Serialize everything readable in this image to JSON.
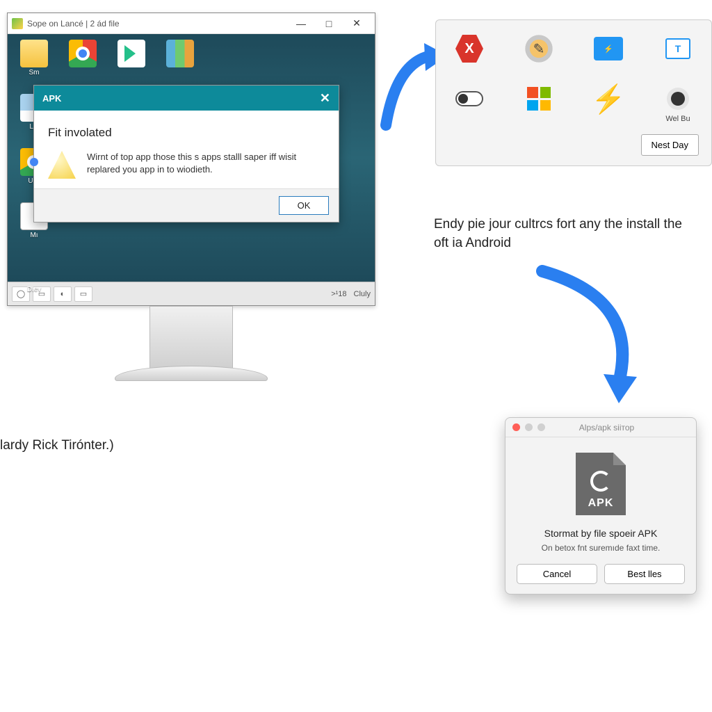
{
  "win_window": {
    "title": "Sope on Lancé | 2 ád file",
    "controls": {
      "min": "—",
      "max": "□",
      "close": "✕"
    }
  },
  "desktop_icons": [
    {
      "label": "Sm",
      "type": "folder"
    },
    {
      "label": "",
      "type": "chrome"
    },
    {
      "label": "",
      "type": "play"
    },
    {
      "label": "",
      "type": "bars"
    },
    {
      "label": "Loi",
      "type": "pic"
    },
    {
      "label": "",
      "type": "blank"
    },
    {
      "label": "",
      "type": "blank"
    },
    {
      "label": "",
      "type": "blank"
    },
    {
      "label": "Uck",
      "type": "chrome"
    },
    {
      "label": "",
      "type": "blank"
    },
    {
      "label": "",
      "type": "blank"
    },
    {
      "label": "",
      "type": "blank"
    },
    {
      "label": "Mı",
      "type": "doc"
    },
    {
      "label": "",
      "type": "blank"
    },
    {
      "label": "",
      "type": "blank"
    },
    {
      "label": "",
      "type": "blank"
    },
    {
      "label": "Dıev",
      "type": "blank"
    }
  ],
  "taskbar": {
    "time": ">¹18",
    "status": "Cluly"
  },
  "apk_dialog": {
    "header": "APK",
    "title": "Fit involated",
    "message": "Wirnt of top app those this s apps stalll saper iff wisit replared you app in to wiodieth.",
    "ok": "OK"
  },
  "panel": {
    "items": [
      {
        "name": "x-icon",
        "label": ""
      },
      {
        "name": "tools-icon",
        "label": ""
      },
      {
        "name": "folder-flash-icon",
        "label": ""
      },
      {
        "name": "window-t-icon",
        "label": ""
      },
      {
        "name": "toggle-icon",
        "label": ""
      },
      {
        "name": "microsoft-icon",
        "label": ""
      },
      {
        "name": "bolt-icon",
        "label": ""
      },
      {
        "name": "webcam-icon",
        "label": "Wel Bu"
      }
    ],
    "button": "Nest Day"
  },
  "mid_text": "Endy pie jour cultrcs fort any the install the oft ia Android",
  "caption_left": "lardy Rick Tirónter.)",
  "mac_dialog": {
    "title": "Alps/apk siітор",
    "file_label": "APK",
    "heading": "Stormat by file spoeir APK",
    "sub": "On betox fnt suremıde faxt time.",
    "cancel": "Cancel",
    "confirm": "Best lles"
  }
}
